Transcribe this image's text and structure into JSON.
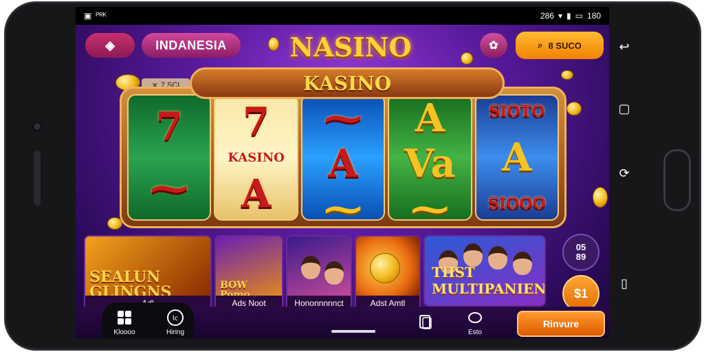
{
  "statusbar": {
    "left_text": "ᴾᴿᴷ",
    "right_text": "286",
    "battery": "180"
  },
  "topbar": {
    "region": "INDANESIA",
    "brand": "NASINO",
    "search_label": "8 SUCO"
  },
  "banner": {
    "title": "KASINO",
    "small_tag": "7 SCI"
  },
  "reels": [
    {
      "style": "green",
      "symbols": [
        "7",
        "⁓"
      ]
    },
    {
      "style": "gold",
      "symbols": [
        "7",
        "KASINO",
        "A"
      ]
    },
    {
      "style": "blue",
      "symbols": [
        "⁓",
        "A",
        "⁓"
      ]
    },
    {
      "style": "green2",
      "symbols": [
        "A",
        "Va",
        "⁓"
      ]
    },
    {
      "style": "blue2",
      "symbols": [
        "SIOTO",
        "A",
        "SIOOO"
      ]
    }
  ],
  "games": [
    {
      "title": "SEALUN GLINGNS",
      "label": "Adl"
    },
    {
      "title": "BOW Pomo",
      "label": "Ads Noot"
    },
    {
      "title": "",
      "label": "Hononnnnnct"
    },
    {
      "title": "",
      "label": "Adst Amtl"
    },
    {
      "title": "TIIST MULTIPANIEN",
      "label": ""
    }
  ],
  "side_badges": {
    "number_top": "05",
    "number_bottom": "89",
    "action": "$1"
  },
  "bottom_nav": [
    {
      "icon": "grid-icon",
      "label": "Kloooo"
    },
    {
      "icon": "chat-icon",
      "label": "Hiring"
    },
    {
      "icon": "cards-icon",
      "label": ""
    },
    {
      "icon": "circle-icon",
      "label": "Esto"
    }
  ],
  "cta": {
    "label": "Rinvure"
  },
  "colors": {
    "accent": "#f08200",
    "brand": "#ffd23a",
    "bg": "#5a1a9e"
  }
}
